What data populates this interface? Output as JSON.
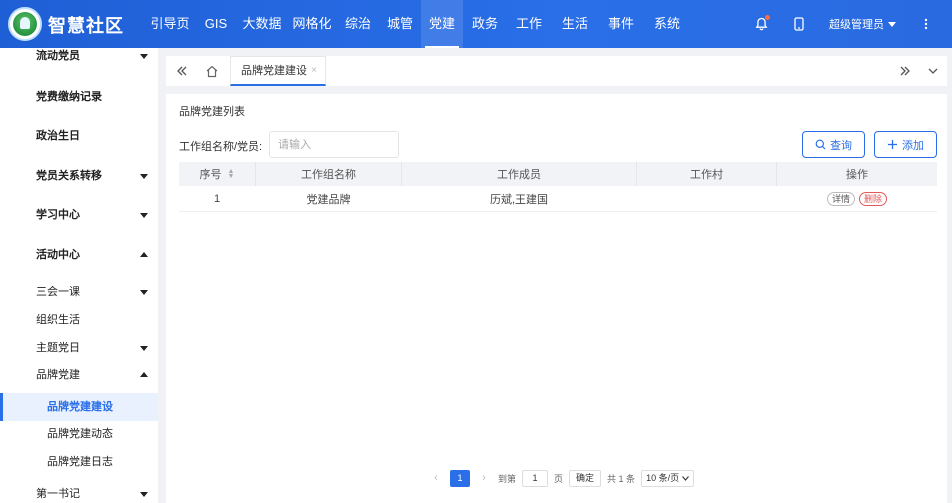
{
  "app": {
    "title": "智慧社区"
  },
  "nav": [
    {
      "label": "引导页",
      "w": 50
    },
    {
      "label": "GIS",
      "w": 42
    },
    {
      "label": "大数据",
      "w": 50
    },
    {
      "label": "网格化",
      "w": 50
    },
    {
      "label": "综治",
      "w": 42
    },
    {
      "label": "城管",
      "w": 42
    },
    {
      "label": "党建",
      "w": 42
    },
    {
      "label": "政务",
      "w": 44
    },
    {
      "label": "工作",
      "w": 44
    },
    {
      "label": "生活",
      "w": 48
    },
    {
      "label": "事件",
      "w": 44
    },
    {
      "label": "系统",
      "w": 48
    }
  ],
  "active_nav": "党建",
  "user": {
    "name": "超级管理员"
  },
  "sidebar": {
    "items": [
      {
        "label": "流动党员",
        "style": "bold",
        "caret": "down"
      },
      {
        "label": "党费缴纳记录",
        "style": "bold",
        "caret": ""
      },
      {
        "label": "政治生日",
        "style": "bold",
        "caret": ""
      },
      {
        "label": "党员关系转移",
        "style": "bold",
        "caret": "down"
      },
      {
        "label": "学习中心",
        "style": "bold",
        "caret": "down"
      },
      {
        "label": "活动中心",
        "style": "bold",
        "caret": "up"
      },
      {
        "label": "三会一课",
        "style": "",
        "caret": "down"
      },
      {
        "label": "组织生活",
        "style": "",
        "caret": ""
      },
      {
        "label": "主题党日",
        "style": "",
        "caret": "down"
      },
      {
        "label": "品牌党建",
        "style": "",
        "caret": "up"
      },
      {
        "label": "品牌党建建设",
        "style": "active",
        "caret": ""
      },
      {
        "label": "品牌党建动态",
        "style": "sub",
        "caret": ""
      },
      {
        "label": "品牌党建日志",
        "style": "sub",
        "caret": ""
      },
      {
        "label": "第一书记",
        "style": "",
        "caret": "down"
      }
    ]
  },
  "tabs": [
    {
      "label": "品牌党建建设",
      "close": "×"
    }
  ],
  "panel": {
    "title": "品牌党建列表",
    "search_label": "工作组名称/党员:",
    "search_placeholder": "请输入",
    "query_label": "查询",
    "add_label": "添加"
  },
  "table": {
    "headers": [
      "序号",
      "工作组名称",
      "工作成员",
      "工作村",
      "操作"
    ],
    "rows": [
      {
        "index": "1",
        "name": "党建品牌",
        "members": "历斌,王建国",
        "village": "",
        "actions": [
          "详情",
          "删除"
        ]
      }
    ]
  },
  "pagination": {
    "current": "1",
    "goto_label": "到第",
    "goto_value": "1",
    "page_unit": "页",
    "confirm_label": "确定",
    "total_label": "共 1 条",
    "page_size": "10 条/页"
  }
}
